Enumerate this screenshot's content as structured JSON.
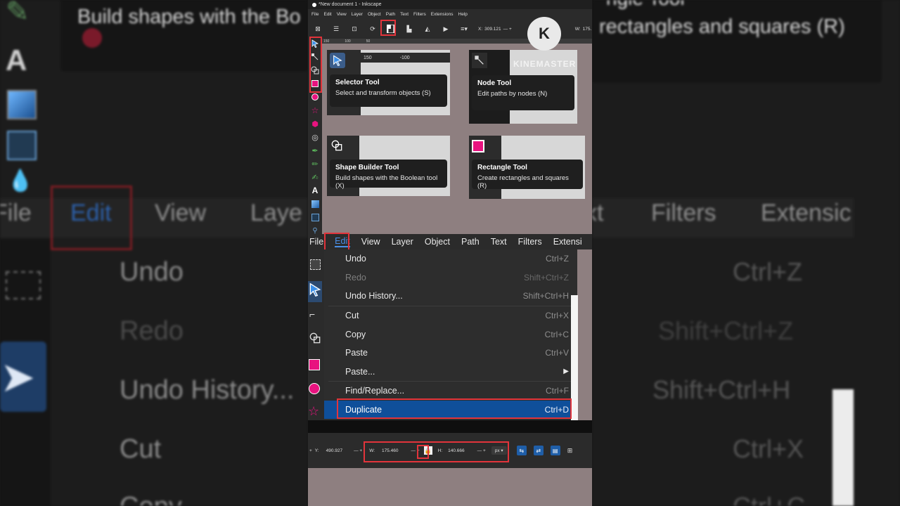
{
  "bg_left": {
    "tip_text": "Build shapes with the Bo",
    "menu_file": "File",
    "menu_edit": "Edit",
    "menu_view": "View",
    "menu_layer": "Laye",
    "items": [
      "Undo",
      "Redo",
      "Undo History...",
      "Cut",
      "Copy"
    ]
  },
  "bg_right": {
    "tip_title": "ngle Tool",
    "tip_text": "rectangles and squares (R)",
    "menu_text": "xt",
    "menu_filters": "Filters",
    "menu_ext": "Extensic",
    "shortcuts": [
      "Ctrl+Z",
      "Shift+Ctrl+Z",
      "Shift+Ctrl+H",
      "Ctrl+X",
      "Ctrl+C"
    ]
  },
  "top": {
    "title": "*New document 1 - Inkscape",
    "menu": [
      "File",
      "Edit",
      "View",
      "Layer",
      "Object",
      "Path",
      "Text",
      "Filters",
      "Extensions",
      "Help"
    ],
    "x_label": "X:",
    "x_value": "309.121",
    "w_label": "W:",
    "w_value": "175.",
    "ruler": [
      "150",
      "100",
      "50"
    ]
  },
  "watermark": {
    "logo": "K",
    "text": "KINEMASTER"
  },
  "cards": {
    "ruler": [
      "150",
      "-100"
    ],
    "selector": {
      "title": "Selector Tool",
      "desc": "Select and transform objects (S)"
    },
    "node": {
      "title": "Node Tool",
      "desc": "Edit paths by nodes (N)"
    },
    "shape": {
      "title": "Shape Builder Tool",
      "desc": "Build shapes with the Boolean tool (X)"
    },
    "rect": {
      "title": "Rectangle Tool",
      "desc": "Create rectangles and squares (R)"
    }
  },
  "edit_menu": {
    "menubar": [
      "File",
      "Edit",
      "View",
      "Layer",
      "Object",
      "Path",
      "Text",
      "Filters",
      "Extensi"
    ],
    "items": [
      {
        "label": "Undo",
        "shortcut": "Ctrl+Z",
        "state": "normal"
      },
      {
        "label": "Redo",
        "shortcut": "Shift+Ctrl+Z",
        "state": "disabled"
      },
      {
        "label": "Undo History...",
        "shortcut": "Shift+Ctrl+H",
        "state": "normal"
      },
      {
        "label": "Cut",
        "shortcut": "Ctrl+X",
        "state": "normal"
      },
      {
        "label": "Copy",
        "shortcut": "Ctrl+C",
        "state": "normal"
      },
      {
        "label": "Paste",
        "shortcut": "Ctrl+V",
        "state": "normal"
      },
      {
        "label": "Paste...",
        "shortcut": "",
        "state": "submenu"
      },
      {
        "label": "Find/Replace...",
        "shortcut": "Ctrl+F",
        "state": "normal"
      },
      {
        "label": "Duplicate",
        "shortcut": "Ctrl+D",
        "state": "selected"
      }
    ]
  },
  "bottom": {
    "y_label": "Y:",
    "y_value": "490.927",
    "w_label": "W:",
    "w_value": "175.460",
    "h_label": "H:",
    "h_value": "140.666",
    "unit": "px"
  },
  "colors": {
    "accent_red": "#e2343b",
    "selection_blue": "#0f4f9a",
    "rect_pink": "#e8137f"
  }
}
